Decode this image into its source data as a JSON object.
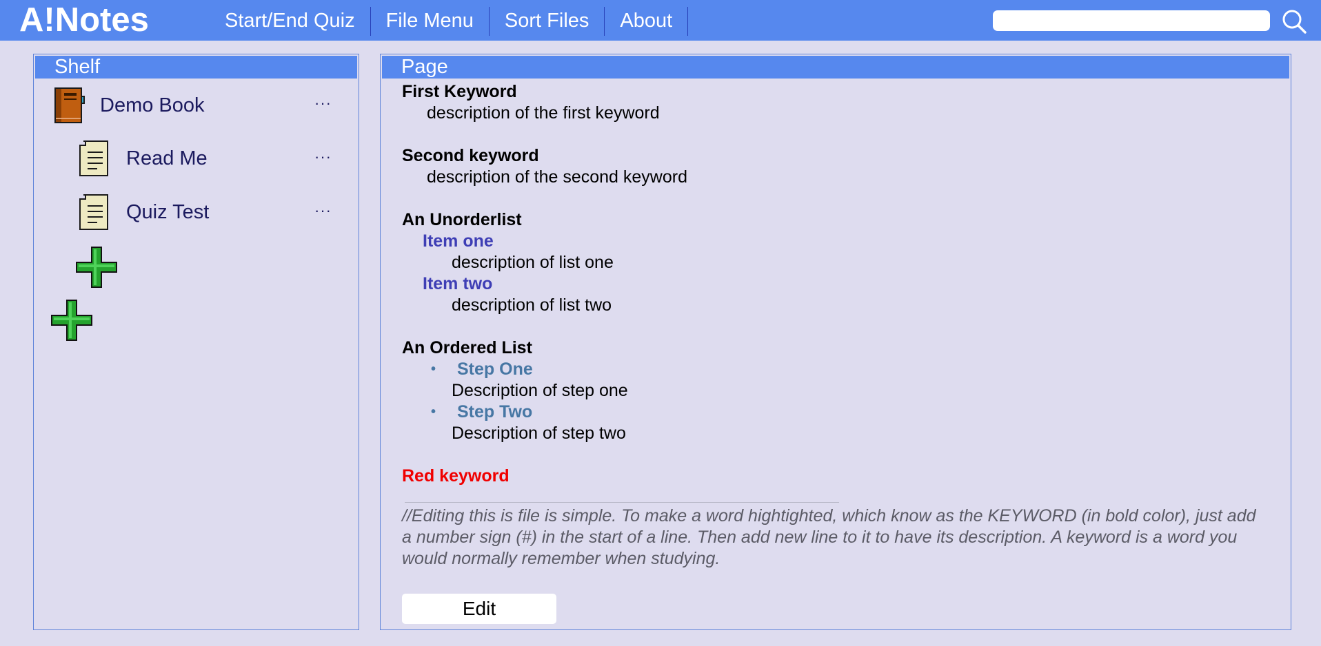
{
  "app": {
    "title": "A!Notes"
  },
  "nav": {
    "items": [
      "Start/End Quiz",
      "File Menu",
      "Sort Files",
      "About"
    ]
  },
  "search": {
    "value": "",
    "placeholder": ""
  },
  "shelf": {
    "title": "Shelf",
    "book": {
      "label": "Demo Book",
      "menu": "···"
    },
    "pages": [
      {
        "label": "Read Me",
        "menu": "···"
      },
      {
        "label": "Quiz Test",
        "menu": "···"
      }
    ],
    "add_page_icon": "plus-icon",
    "add_book_icon": "plus-icon"
  },
  "page": {
    "title": "Page",
    "entries": [
      {
        "keyword": "First Keyword",
        "description": "description of the first keyword"
      },
      {
        "keyword": "Second keyword",
        "description": "description of the second keyword"
      }
    ],
    "unordered": {
      "title": "An Unorderlist",
      "items": [
        {
          "keyword": "Item one",
          "description": "description of list one"
        },
        {
          "keyword": "Item two",
          "description": "description of list two"
        }
      ]
    },
    "ordered": {
      "title": "An Ordered List",
      "items": [
        {
          "bullet": "•",
          "keyword": "Step One",
          "description": "Description of step one"
        },
        {
          "bullet": "•",
          "keyword": "Step Two",
          "description": "Description of step two"
        }
      ]
    },
    "red_keyword": "Red keyword",
    "comment": "//Editing this is file is simple. To make a word hightighted, which know as the KEYWORD (in bold color), just add a number sign (#) in the start of a line. Then add new line to it to have its description. A keyword is a word you would normally remember when studying.",
    "edit_label": "Edit"
  },
  "colors": {
    "topbar": "#5688ee",
    "background": "#dedcef",
    "sub_keyword": "#3e3eb5",
    "step_keyword": "#4777a4",
    "red_keyword": "#f00000"
  }
}
